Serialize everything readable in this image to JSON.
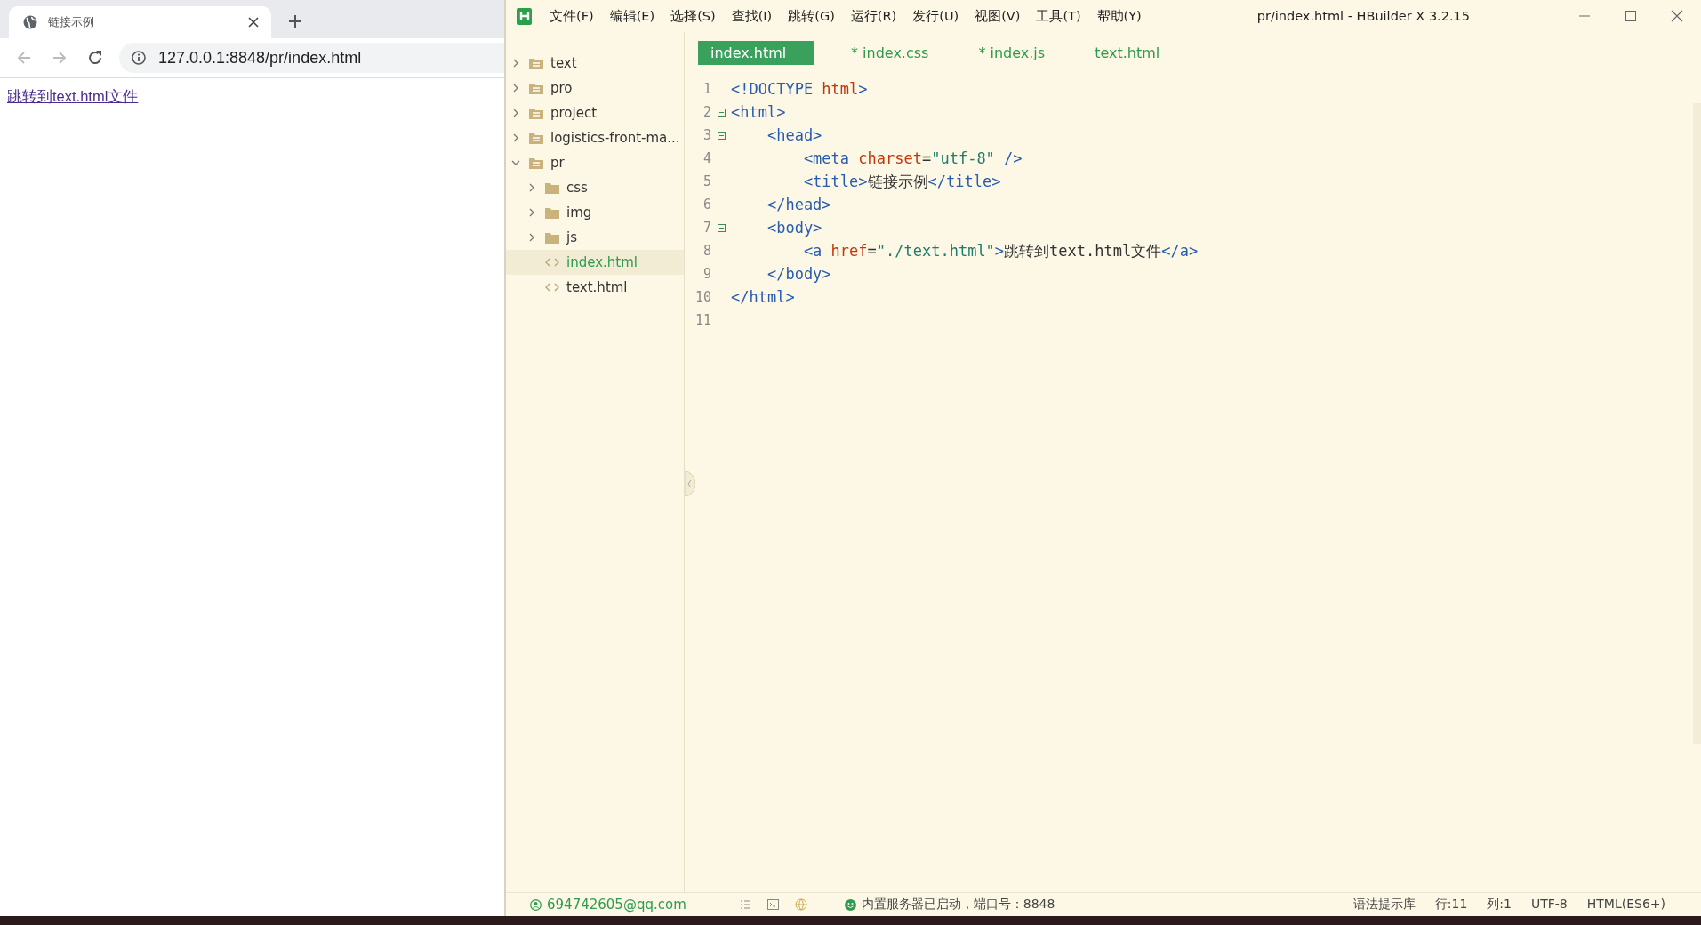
{
  "browser": {
    "tab": {
      "title": "链接示例",
      "selected": true
    },
    "address": "127.0.0.1:8848/pr/index.html",
    "page_link": "跳转到text.html文件"
  },
  "editor_window": {
    "menu": [
      "文件(F)",
      "编辑(E)",
      "选择(S)",
      "查找(I)",
      "跳转(G)",
      "运行(R)",
      "发行(U)",
      "视图(V)",
      "工具(T)",
      "帮助(Y)"
    ],
    "title": "pr/index.html - HBuilder X 3.2.15",
    "tree": [
      {
        "label": "text",
        "kind": "project",
        "expanded": false,
        "selected": false
      },
      {
        "label": "pro",
        "kind": "project",
        "expanded": false,
        "selected": false
      },
      {
        "label": "project",
        "kind": "project",
        "expanded": false,
        "selected": false
      },
      {
        "label": "logistics-front-ma...",
        "kind": "project",
        "expanded": false,
        "selected": false
      },
      {
        "label": "pr",
        "kind": "project",
        "expanded": true,
        "selected": false,
        "children": [
          {
            "label": "css",
            "kind": "folder",
            "expanded": false,
            "selected": false
          },
          {
            "label": "img",
            "kind": "folder",
            "expanded": false,
            "selected": false
          },
          {
            "label": "js",
            "kind": "folder",
            "expanded": false,
            "selected": false
          },
          {
            "label": "index.html",
            "kind": "file",
            "selected": true
          },
          {
            "label": "text.html",
            "kind": "file",
            "selected": false
          }
        ]
      }
    ],
    "tabs": [
      {
        "label": "index.html",
        "selected": true
      },
      {
        "label": "* index.css",
        "selected": false
      },
      {
        "label": "* index.js",
        "selected": false
      },
      {
        "label": "text.html",
        "selected": false
      }
    ],
    "code": [
      {
        "number": "1",
        "foldable": false,
        "tokens": [
          {
            "kind": "tag",
            "text": "<!DOCTYPE "
          },
          {
            "kind": "attr",
            "text": "html"
          },
          {
            "kind": "tag",
            "text": ">"
          }
        ]
      },
      {
        "number": "2",
        "foldable": true,
        "tokens": [
          {
            "kind": "tag",
            "text": "<html>"
          }
        ]
      },
      {
        "number": "3",
        "foldable": true,
        "tokens": [
          {
            "kind": "tag",
            "text": "    <head>"
          }
        ]
      },
      {
        "number": "4",
        "foldable": false,
        "tokens": [
          {
            "kind": "tag",
            "text": "        <meta "
          },
          {
            "kind": "attr",
            "text": "charset"
          },
          {
            "kind": "plain",
            "text": "="
          },
          {
            "kind": "str",
            "text": "\"utf-8\""
          },
          {
            "kind": "tag",
            "text": " />"
          }
        ]
      },
      {
        "number": "5",
        "foldable": false,
        "tokens": [
          {
            "kind": "tag",
            "text": "        <title>"
          },
          {
            "kind": "plain",
            "text": "链接示例"
          },
          {
            "kind": "tag",
            "text": "</title>"
          }
        ]
      },
      {
        "number": "6",
        "foldable": false,
        "tokens": [
          {
            "kind": "tag",
            "text": "    </head>"
          }
        ]
      },
      {
        "number": "7",
        "foldable": true,
        "tokens": [
          {
            "kind": "tag",
            "text": "    <body>"
          }
        ]
      },
      {
        "number": "8",
        "foldable": false,
        "tokens": [
          {
            "kind": "tag",
            "text": "        <a "
          },
          {
            "kind": "attr",
            "text": "href"
          },
          {
            "kind": "plain",
            "text": "="
          },
          {
            "kind": "str",
            "text": "\"./text.html\""
          },
          {
            "kind": "tag",
            "text": ">"
          },
          {
            "kind": "plain",
            "text": "跳转到text.html文件"
          },
          {
            "kind": "tag",
            "text": "</a>"
          }
        ]
      },
      {
        "number": "9",
        "foldable": false,
        "tokens": [
          {
            "kind": "tag",
            "text": "    </body>"
          }
        ]
      },
      {
        "number": "10",
        "foldable": false,
        "tokens": [
          {
            "kind": "tag",
            "text": "</html>"
          }
        ]
      },
      {
        "number": "11",
        "foldable": false
      }
    ],
    "status_bar": {
      "account": "694742605@qq.com",
      "server": "内置服务器已启动，端口号：8848",
      "right": [
        "语法提示库",
        "行:11",
        "列:1",
        "UTF-8",
        "HTML(ES6+)"
      ]
    }
  }
}
